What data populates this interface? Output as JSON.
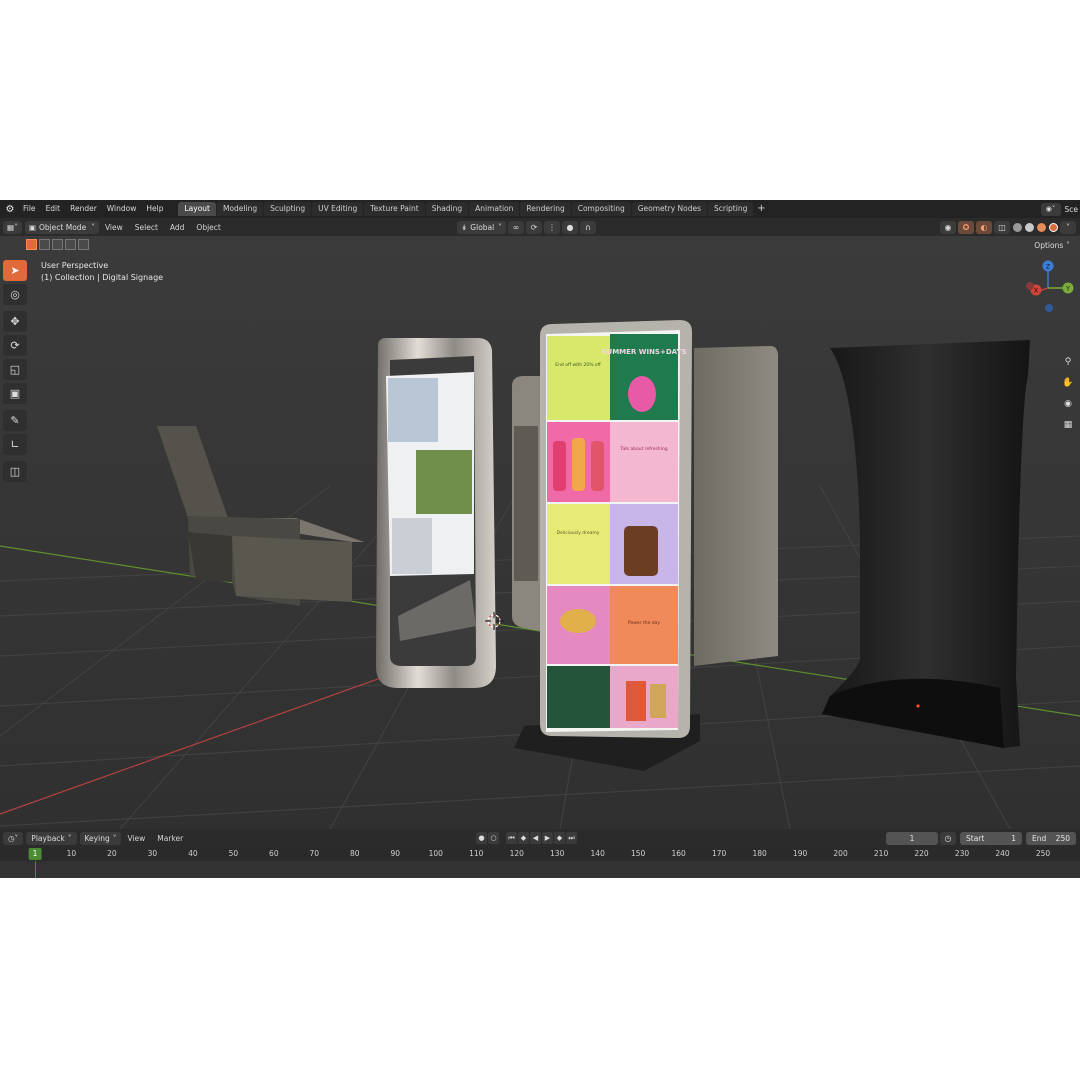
{
  "topbar": {
    "menus": [
      "File",
      "Edit",
      "Render",
      "Window",
      "Help"
    ],
    "workspaces": [
      "Layout",
      "Modeling",
      "Sculpting",
      "UV Editing",
      "Texture Paint",
      "Shading",
      "Animation",
      "Rendering",
      "Compositing",
      "Geometry Nodes",
      "Scripting"
    ],
    "active_workspace": "Layout",
    "add_tab": "+",
    "scene_label": "Sce"
  },
  "header": {
    "mode": "Object Mode",
    "menus": [
      "View",
      "Select",
      "Add",
      "Object"
    ],
    "orientation": "Global",
    "options_label": "Options"
  },
  "viewport": {
    "perspective": "User Perspective",
    "collection": "(1) Collection | Digital Signage",
    "gizmo": {
      "z": "Z",
      "y": "Y",
      "x": "X"
    }
  },
  "sign_text": {
    "panel1": "End off with 20% off",
    "panel2": "SUMMER WINS+DAYS",
    "panel3": "Talk about refreshing",
    "panel4": "Deliciously dreamy",
    "panel5": "Power the day"
  },
  "timeline": {
    "menus": [
      "Playback",
      "Keying",
      "View",
      "Marker"
    ],
    "current_frame": "1",
    "start_label": "Start",
    "start": "1",
    "end_label": "End",
    "end": "250",
    "ticks": [
      "10",
      "20",
      "30",
      "40",
      "50",
      "60",
      "70",
      "80",
      "90",
      "100",
      "110",
      "120",
      "130",
      "140",
      "150",
      "160",
      "170",
      "180",
      "190",
      "200",
      "210",
      "220",
      "230",
      "240",
      "250"
    ]
  },
  "colors": {
    "accent": "#e06a3a",
    "frame_green": "#4b8b32",
    "axis_x": "#b84040",
    "axis_y": "#5f8f2f"
  }
}
